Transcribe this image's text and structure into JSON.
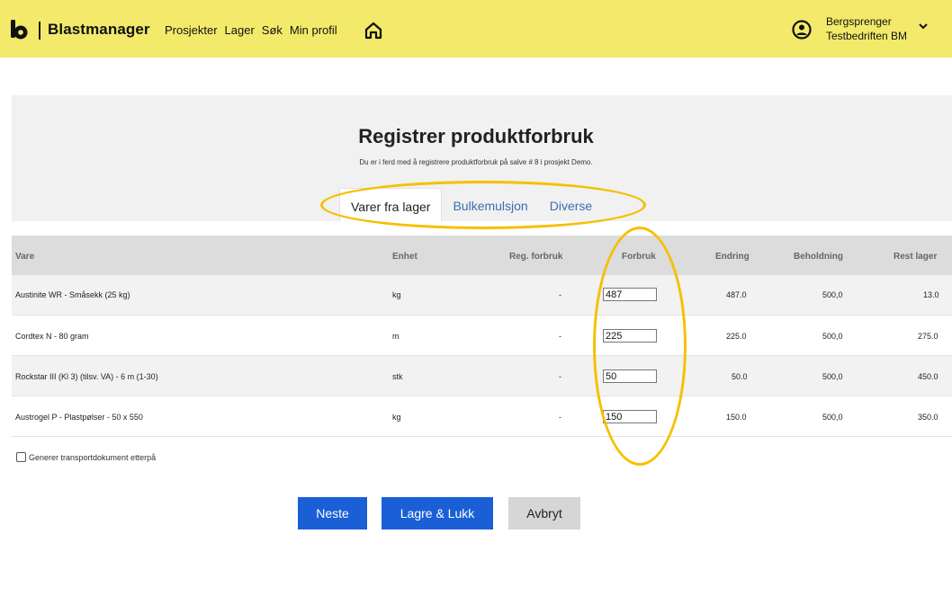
{
  "header": {
    "brand": "Blastmanager",
    "nav": [
      "Prosjekter",
      "Lager",
      "Søk",
      "Min profil"
    ],
    "home_icon": "home-icon",
    "user": {
      "role": "Bergsprenger",
      "company": "Testbedriften BM"
    },
    "colors": {
      "header_bg": "#f3ea6b"
    }
  },
  "page": {
    "title": "Registrer produktforbruk",
    "subtitle": "Du er i ferd med å registrere produktforbruk på salve # 8 i prosjekt Demo.",
    "tabs": [
      {
        "label": "Varer fra lager",
        "active": true
      },
      {
        "label": "Bulkemulsjon",
        "active": false
      },
      {
        "label": "Diverse",
        "active": false
      }
    ]
  },
  "table": {
    "columns": [
      "Vare",
      "Enhet",
      "Reg. forbruk",
      "Forbruk",
      "Endring",
      "Beholdning",
      "Rest lager"
    ],
    "rows": [
      {
        "vare": "Austinite WR - Småsekk (25 kg)",
        "enhet": "kg",
        "reg": "-",
        "forbruk": "487",
        "endring": "487.0",
        "beholdning": "500,0",
        "rest": "13.0"
      },
      {
        "vare": "Cordtex N - 80 gram",
        "enhet": "m",
        "reg": "-",
        "forbruk": "225",
        "endring": "225.0",
        "beholdning": "500,0",
        "rest": "275.0"
      },
      {
        "vare": "Rockstar III (Kl 3) (tilsv. VA) - 6 m (1-30)",
        "enhet": "stk",
        "reg": "-",
        "forbruk": "50",
        "endring": "50.0",
        "beholdning": "500,0",
        "rest": "450.0"
      },
      {
        "vare": "Austrogel P - Plastpølser - 50 x 550",
        "enhet": "kg",
        "reg": "-",
        "forbruk": "150",
        "endring": "150.0",
        "beholdning": "500,0",
        "rest": "350.0"
      }
    ]
  },
  "options": {
    "transport_label": "Generer transportdokument etterpå",
    "transport_checked": false
  },
  "buttons": {
    "next": "Neste",
    "save_close": "Lagre & Lukk",
    "cancel": "Avbryt"
  },
  "colors": {
    "primary": "#1a5fd6",
    "highlight": "#f5c000"
  }
}
